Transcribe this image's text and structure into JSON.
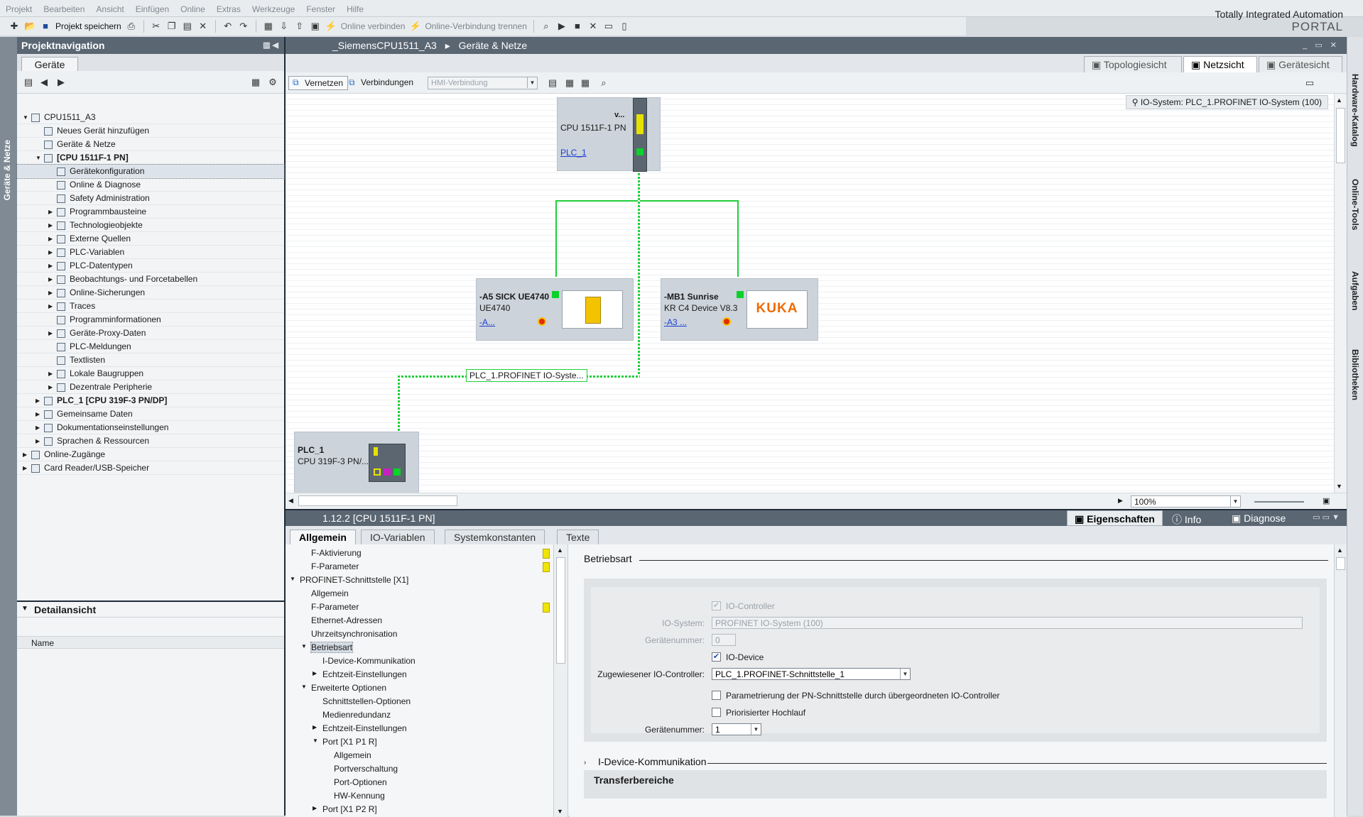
{
  "menu": [
    "Projekt",
    "Bearbeiten",
    "Ansicht",
    "Einfügen",
    "Online",
    "Extras",
    "Werkzeuge",
    "Fenster",
    "Hilfe"
  ],
  "brand": {
    "line1": "Totally Integrated Automation",
    "line2": "PORTAL"
  },
  "toolbar": {
    "save_label": "Projekt speichern",
    "online_connect": "Online verbinden",
    "online_disconnect": "Online-Verbindung trennen"
  },
  "leftvtab": "Geräte & Netze",
  "projnav": {
    "title": "Projektnavigation",
    "tab": "Geräte",
    "tree": [
      {
        "label": "CPU1511_A3",
        "indent": 0,
        "arrow": "▼",
        "bold": false
      },
      {
        "label": "Neues Gerät hinzufügen",
        "indent": 1,
        "arrow": "",
        "bold": false
      },
      {
        "label": "Geräte & Netze",
        "indent": 1,
        "arrow": "",
        "bold": false
      },
      {
        "label": "[CPU 1511F-1 PN]",
        "indent": 1,
        "arrow": "▼",
        "bold": true
      },
      {
        "label": "Gerätekonfiguration",
        "indent": 2,
        "arrow": "",
        "bold": false,
        "selected": true
      },
      {
        "label": "Online & Diagnose",
        "indent": 2,
        "arrow": "",
        "bold": false
      },
      {
        "label": "Safety Administration",
        "indent": 2,
        "arrow": "",
        "bold": false
      },
      {
        "label": "Programmbausteine",
        "indent": 2,
        "arrow": "▶",
        "bold": false
      },
      {
        "label": "Technologieobjekte",
        "indent": 2,
        "arrow": "▶",
        "bold": false
      },
      {
        "label": "Externe Quellen",
        "indent": 2,
        "arrow": "▶",
        "bold": false
      },
      {
        "label": "PLC-Variablen",
        "indent": 2,
        "arrow": "▶",
        "bold": false
      },
      {
        "label": "PLC-Datentypen",
        "indent": 2,
        "arrow": "▶",
        "bold": false
      },
      {
        "label": "Beobachtungs- und Forcetabellen",
        "indent": 2,
        "arrow": "▶",
        "bold": false
      },
      {
        "label": "Online-Sicherungen",
        "indent": 2,
        "arrow": "▶",
        "bold": false
      },
      {
        "label": "Traces",
        "indent": 2,
        "arrow": "▶",
        "bold": false
      },
      {
        "label": "Programminformationen",
        "indent": 2,
        "arrow": "",
        "bold": false
      },
      {
        "label": "Geräte-Proxy-Daten",
        "indent": 2,
        "arrow": "▶",
        "bold": false
      },
      {
        "label": "PLC-Meldungen",
        "indent": 2,
        "arrow": "",
        "bold": false
      },
      {
        "label": "Textlisten",
        "indent": 2,
        "arrow": "",
        "bold": false
      },
      {
        "label": "Lokale Baugruppen",
        "indent": 2,
        "arrow": "▶",
        "bold": false
      },
      {
        "label": "Dezentrale Peripherie",
        "indent": 2,
        "arrow": "▶",
        "bold": false
      },
      {
        "label": "PLC_1 [CPU 319F-3 PN/DP]",
        "indent": 1,
        "arrow": "▶",
        "bold": true
      },
      {
        "label": "Gemeinsame Daten",
        "indent": 1,
        "arrow": "▶",
        "bold": false
      },
      {
        "label": "Dokumentationseinstellungen",
        "indent": 1,
        "arrow": "▶",
        "bold": false
      },
      {
        "label": "Sprachen & Ressourcen",
        "indent": 1,
        "arrow": "▶",
        "bold": false
      },
      {
        "label": "Online-Zugänge",
        "indent": 0,
        "arrow": "▶",
        "bold": false
      },
      {
        "label": "Card Reader/USB-Speicher",
        "indent": 0,
        "arrow": "▶",
        "bold": false
      }
    ]
  },
  "detail": {
    "title": "Detailansicht",
    "col_name": "Name"
  },
  "editor": {
    "breadcrumb_project": "_SiemensCPU1511_A3",
    "breadcrumb_sep": "▸",
    "breadcrumb_page": "Geräte & Netze",
    "view_tabs": [
      "Topologiesicht",
      "Netzsicht",
      "Gerätesicht"
    ],
    "btn_vernetzen": "Vernetzen",
    "btn_verbindungen": "Verbindungen",
    "hmi_dropdown": "HMI-Verbindung",
    "io_system_label": "IO-System: PLC_1.PROFINET IO-System (100)",
    "zoom": "100%"
  },
  "devices": {
    "cpu": {
      "name": "v...",
      "type": "CPU 1511F-1 PN",
      "link": "PLC_1"
    },
    "sick": {
      "name": "-A5 SICK UE4740",
      "type": "UE4740",
      "link": "-A..."
    },
    "kuka": {
      "name": "-MB1 Sunrise",
      "type": "KR C4 Device V8.3",
      "link": "-A3 ...",
      "logo": "KUKA"
    },
    "plc1": {
      "name": "PLC_1",
      "type": "CPU 319F-3 PN/..."
    }
  },
  "network_label": "PLC_1.PROFINET IO-Syste...",
  "right_tabs": [
    "Hardware-Katalog",
    "Online-Tools",
    "Aufgaben",
    "Bibliotheken"
  ],
  "inspector": {
    "title": "1.12.2 [CPU 1511F-1 PN]",
    "tabs": [
      "Eigenschaften",
      "Info",
      "Diagnose"
    ],
    "subtabs": [
      "Allgemein",
      "IO-Variablen",
      "Systemkonstanten",
      "Texte"
    ],
    "tree": [
      {
        "label": "F-Aktivierung",
        "indent": 1,
        "arrow": "",
        "warn": true
      },
      {
        "label": "F-Parameter",
        "indent": 1,
        "arrow": "",
        "warn": true
      },
      {
        "label": "PROFINET-Schnittstelle [X1]",
        "indent": 0,
        "arrow": "▼",
        "warn": false
      },
      {
        "label": "Allgemein",
        "indent": 1,
        "arrow": "",
        "warn": false
      },
      {
        "label": "F-Parameter",
        "indent": 1,
        "arrow": "",
        "warn": true
      },
      {
        "label": "Ethernet-Adressen",
        "indent": 1,
        "arrow": "",
        "warn": false
      },
      {
        "label": "Uhrzeitsynchronisation",
        "indent": 1,
        "arrow": "",
        "warn": false
      },
      {
        "label": "Betriebsart",
        "indent": 1,
        "arrow": "▼",
        "warn": false,
        "selected": true
      },
      {
        "label": "I-Device-Kommunikation",
        "indent": 2,
        "arrow": "",
        "warn": false
      },
      {
        "label": "Echtzeit-Einstellungen",
        "indent": 2,
        "arrow": "▶",
        "warn": false
      },
      {
        "label": "Erweiterte Optionen",
        "indent": 1,
        "arrow": "▼",
        "warn": false
      },
      {
        "label": "Schnittstellen-Optionen",
        "indent": 2,
        "arrow": "",
        "warn": false
      },
      {
        "label": "Medienredundanz",
        "indent": 2,
        "arrow": "",
        "warn": false
      },
      {
        "label": "Echtzeit-Einstellungen",
        "indent": 2,
        "arrow": "▶",
        "warn": false
      },
      {
        "label": "Port [X1 P1 R]",
        "indent": 2,
        "arrow": "▼",
        "warn": false
      },
      {
        "label": "Allgemein",
        "indent": 3,
        "arrow": "",
        "warn": false
      },
      {
        "label": "Portverschaltung",
        "indent": 3,
        "arrow": "",
        "warn": false
      },
      {
        "label": "Port-Optionen",
        "indent": 3,
        "arrow": "",
        "warn": false
      },
      {
        "label": "HW-Kennung",
        "indent": 3,
        "arrow": "",
        "warn": false
      },
      {
        "label": "Port [X1 P2 R]",
        "indent": 2,
        "arrow": "▶",
        "warn": false
      }
    ],
    "section": "Betriebsart",
    "io_controller_label": "IO-Controller",
    "io_system_lbl": "IO-System:",
    "io_system_val": "PROFINET IO-System (100)",
    "devnum_lbl": "Gerätenummer:",
    "devnum_val": "0",
    "io_device_label": "IO-Device",
    "assigned_lbl": "Zugewiesener IO-Controller:",
    "assigned_val": "PLC_1.PROFINET-Schnittstelle_1",
    "param_label": "Parametrierung der PN-Schnittstelle durch übergeordneten IO-Controller",
    "prio_label": "Priorisierter Hochlauf",
    "devnum2_lbl": "Gerätenummer:",
    "devnum2_val": "1",
    "idevice_section": "I-Device-Kommunikation",
    "transfer": "Transferbereiche"
  }
}
